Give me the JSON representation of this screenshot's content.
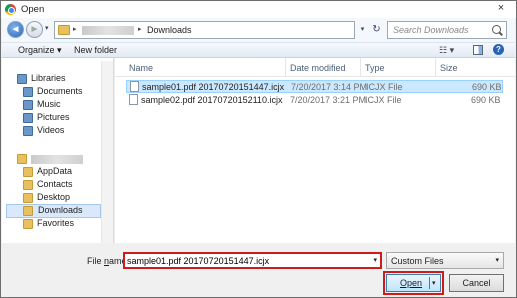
{
  "window": {
    "title": "Open",
    "close_glyph": "×",
    "icon": "chrome-icon"
  },
  "nav": {
    "back_glyph": "◄",
    "forward_glyph": "►",
    "address": {
      "path_current": "Downloads",
      "separator": "▸"
    },
    "search_placeholder": "Search Downloads",
    "refresh_glyph": "↻",
    "dropdown_glyph": "▾"
  },
  "toolbar": {
    "organize_label": "Organize ▾",
    "new_folder_label": "New folder",
    "view_glyph": "☷ ▾",
    "help_glyph": "?"
  },
  "sidebar": {
    "items": [
      {
        "label": "Libraries",
        "icon": "libraries-icon"
      },
      {
        "label": "Documents",
        "icon": "documents-icon"
      },
      {
        "label": "Music",
        "icon": "music-icon"
      },
      {
        "label": "Pictures",
        "icon": "pictures-icon"
      },
      {
        "label": "Videos",
        "icon": "videos-icon"
      },
      {
        "label": "AppData",
        "icon": "folder-icon"
      },
      {
        "label": "Contacts",
        "icon": "contacts-icon"
      },
      {
        "label": "Desktop",
        "icon": "desktop-icon"
      },
      {
        "label": "Downloads",
        "icon": "downloads-icon",
        "selected": true
      },
      {
        "label": "Favorites",
        "icon": "favorites-icon"
      }
    ]
  },
  "file_list": {
    "columns": [
      "Name",
      "Date modified",
      "Type",
      "Size"
    ],
    "rows": [
      {
        "name": "sample01.pdf 20170720151447.icjx",
        "date": "7/20/2017 3:14 PM",
        "type": "ICJX File",
        "size": "690 KB",
        "selected": true
      },
      {
        "name": "sample02.pdf 20170720152110.icjx",
        "date": "7/20/2017 3:21 PM",
        "type": "ICJX File",
        "size": "690 KB",
        "selected": false
      }
    ]
  },
  "footer": {
    "filename_label_prefix": "File ",
    "filename_label_underlined": "n",
    "filename_label_suffix": "ame:",
    "filename_value": "sample01.pdf 20170720151447.icjx",
    "filetype_value": "Custom Files",
    "open_label": "Open",
    "cancel_label": "Cancel"
  },
  "colors": {
    "highlight_outline": "#d11a1a",
    "selection": "#cce8ff",
    "sidebar_selection": "#d9e8fb"
  }
}
